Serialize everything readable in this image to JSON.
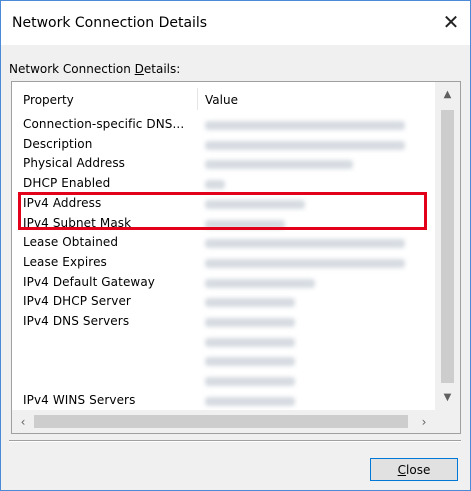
{
  "window": {
    "title": "Network Connection Details",
    "close_glyph": "✕"
  },
  "group": {
    "label_prefix": "Network Connection ",
    "label_accel": "D",
    "label_suffix": "etails:"
  },
  "table": {
    "columns": [
      "Property",
      "Value"
    ],
    "rows": [
      {
        "property": "Connection-specific DNS..."
      },
      {
        "property": "Description"
      },
      {
        "property": "Physical Address"
      },
      {
        "property": "DHCP Enabled"
      },
      {
        "property": "IPv4 Address"
      },
      {
        "property": "IPv4 Subnet Mask"
      },
      {
        "property": "Lease Obtained"
      },
      {
        "property": "Lease Expires"
      },
      {
        "property": "IPv4 Default Gateway"
      },
      {
        "property": "IPv4 DHCP Server"
      },
      {
        "property": "IPv4 DNS Servers"
      },
      {
        "property": ""
      },
      {
        "property": ""
      },
      {
        "property": ""
      },
      {
        "property": "IPv4 WINS Servers"
      },
      {
        "property": ""
      }
    ],
    "highlighted_rows": [
      "IPv4 Address",
      "IPv4 Subnet Mask"
    ],
    "value_note": "values obscured (blurred)"
  },
  "scrollbars": {
    "up": "▲",
    "down": "▼",
    "left": "‹",
    "right": "›"
  },
  "buttons": {
    "close_accel": "C",
    "close_rest": "lose"
  },
  "colors": {
    "highlight": "#e3001b",
    "window_border": "#4b8ad6",
    "button_focus": "#0078d7"
  }
}
